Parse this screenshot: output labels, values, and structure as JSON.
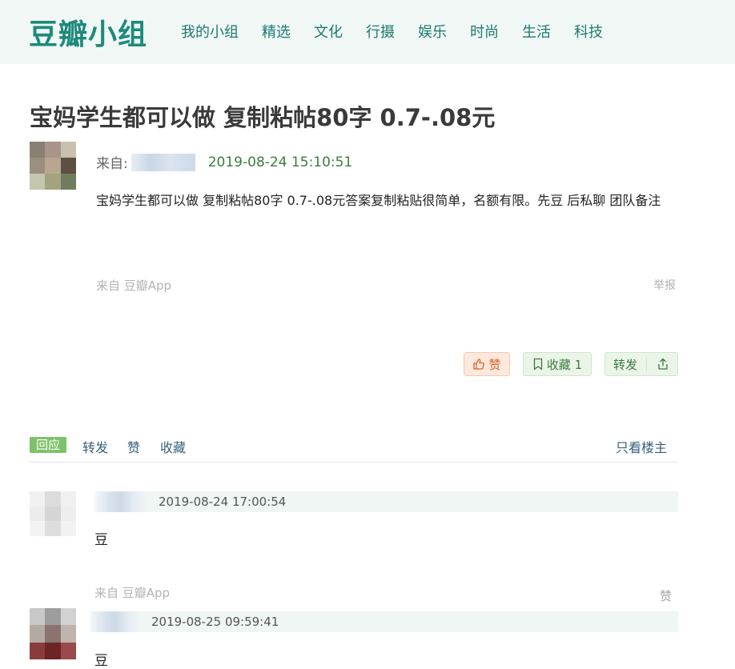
{
  "header": {
    "logo": "豆瓣小组",
    "nav": [
      "我的小组",
      "精选",
      "文化",
      "行摄",
      "娱乐",
      "时尚",
      "生活",
      "科技"
    ]
  },
  "post": {
    "title": "宝妈学生都可以做 复制粘帖80字 0.7-.08元",
    "from_label": "来自:",
    "time": "2019-08-24 15:10:51",
    "body": "宝妈学生都可以做 复制粘帖80字 0.7-.08元答案复制粘贴很简单，名额有限。先豆 后私聊 团队备注",
    "source": "来自 豆瓣App",
    "report": "举报",
    "actions": {
      "like": "赞",
      "collect": "收藏 1",
      "share": "转发"
    }
  },
  "tabs": {
    "reply": "回应",
    "repost": "转发",
    "like": "赞",
    "collect": "收藏",
    "only_op": "只看楼主"
  },
  "comments": [
    {
      "time": "2019-08-24 17:00:54",
      "text": "豆",
      "source": "来自 豆瓣App",
      "like": "赞"
    },
    {
      "time": "2019-08-25 09:59:41",
      "text": "豆"
    }
  ],
  "colors": {
    "brand": "#1d8a7b",
    "header_bg": "#f0f7f4",
    "like_btn_bg": "#fde8dc",
    "collect_btn_bg": "#eaf5e8",
    "reply_tab_bg": "#7cc26a",
    "time_green": "#3b7d3b"
  }
}
